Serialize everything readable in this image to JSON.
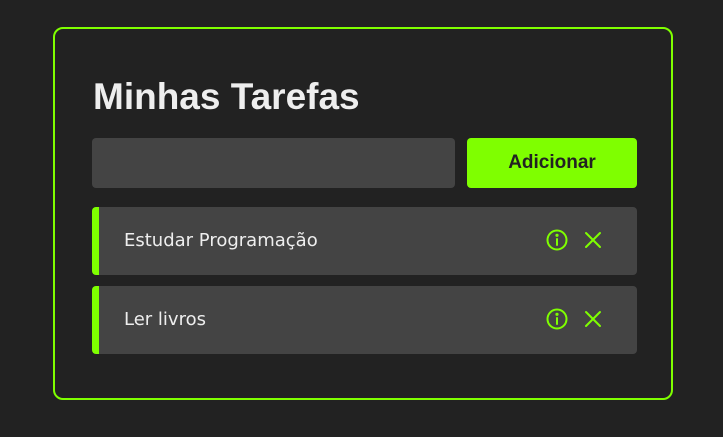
{
  "app": {
    "title": "Minhas Tarefas"
  },
  "form": {
    "input_value": "",
    "add_label": "Adicionar"
  },
  "tasks": [
    {
      "title": "Estudar Programação",
      "info_icon": "info-icon",
      "remove_icon": "close-icon"
    },
    {
      "title": "Ler livros",
      "info_icon": "info-icon",
      "remove_icon": "close-icon"
    }
  ],
  "colors": {
    "accent": "#7fff00",
    "background": "#222222",
    "surface": "#444444",
    "text": "#eeeeee"
  }
}
